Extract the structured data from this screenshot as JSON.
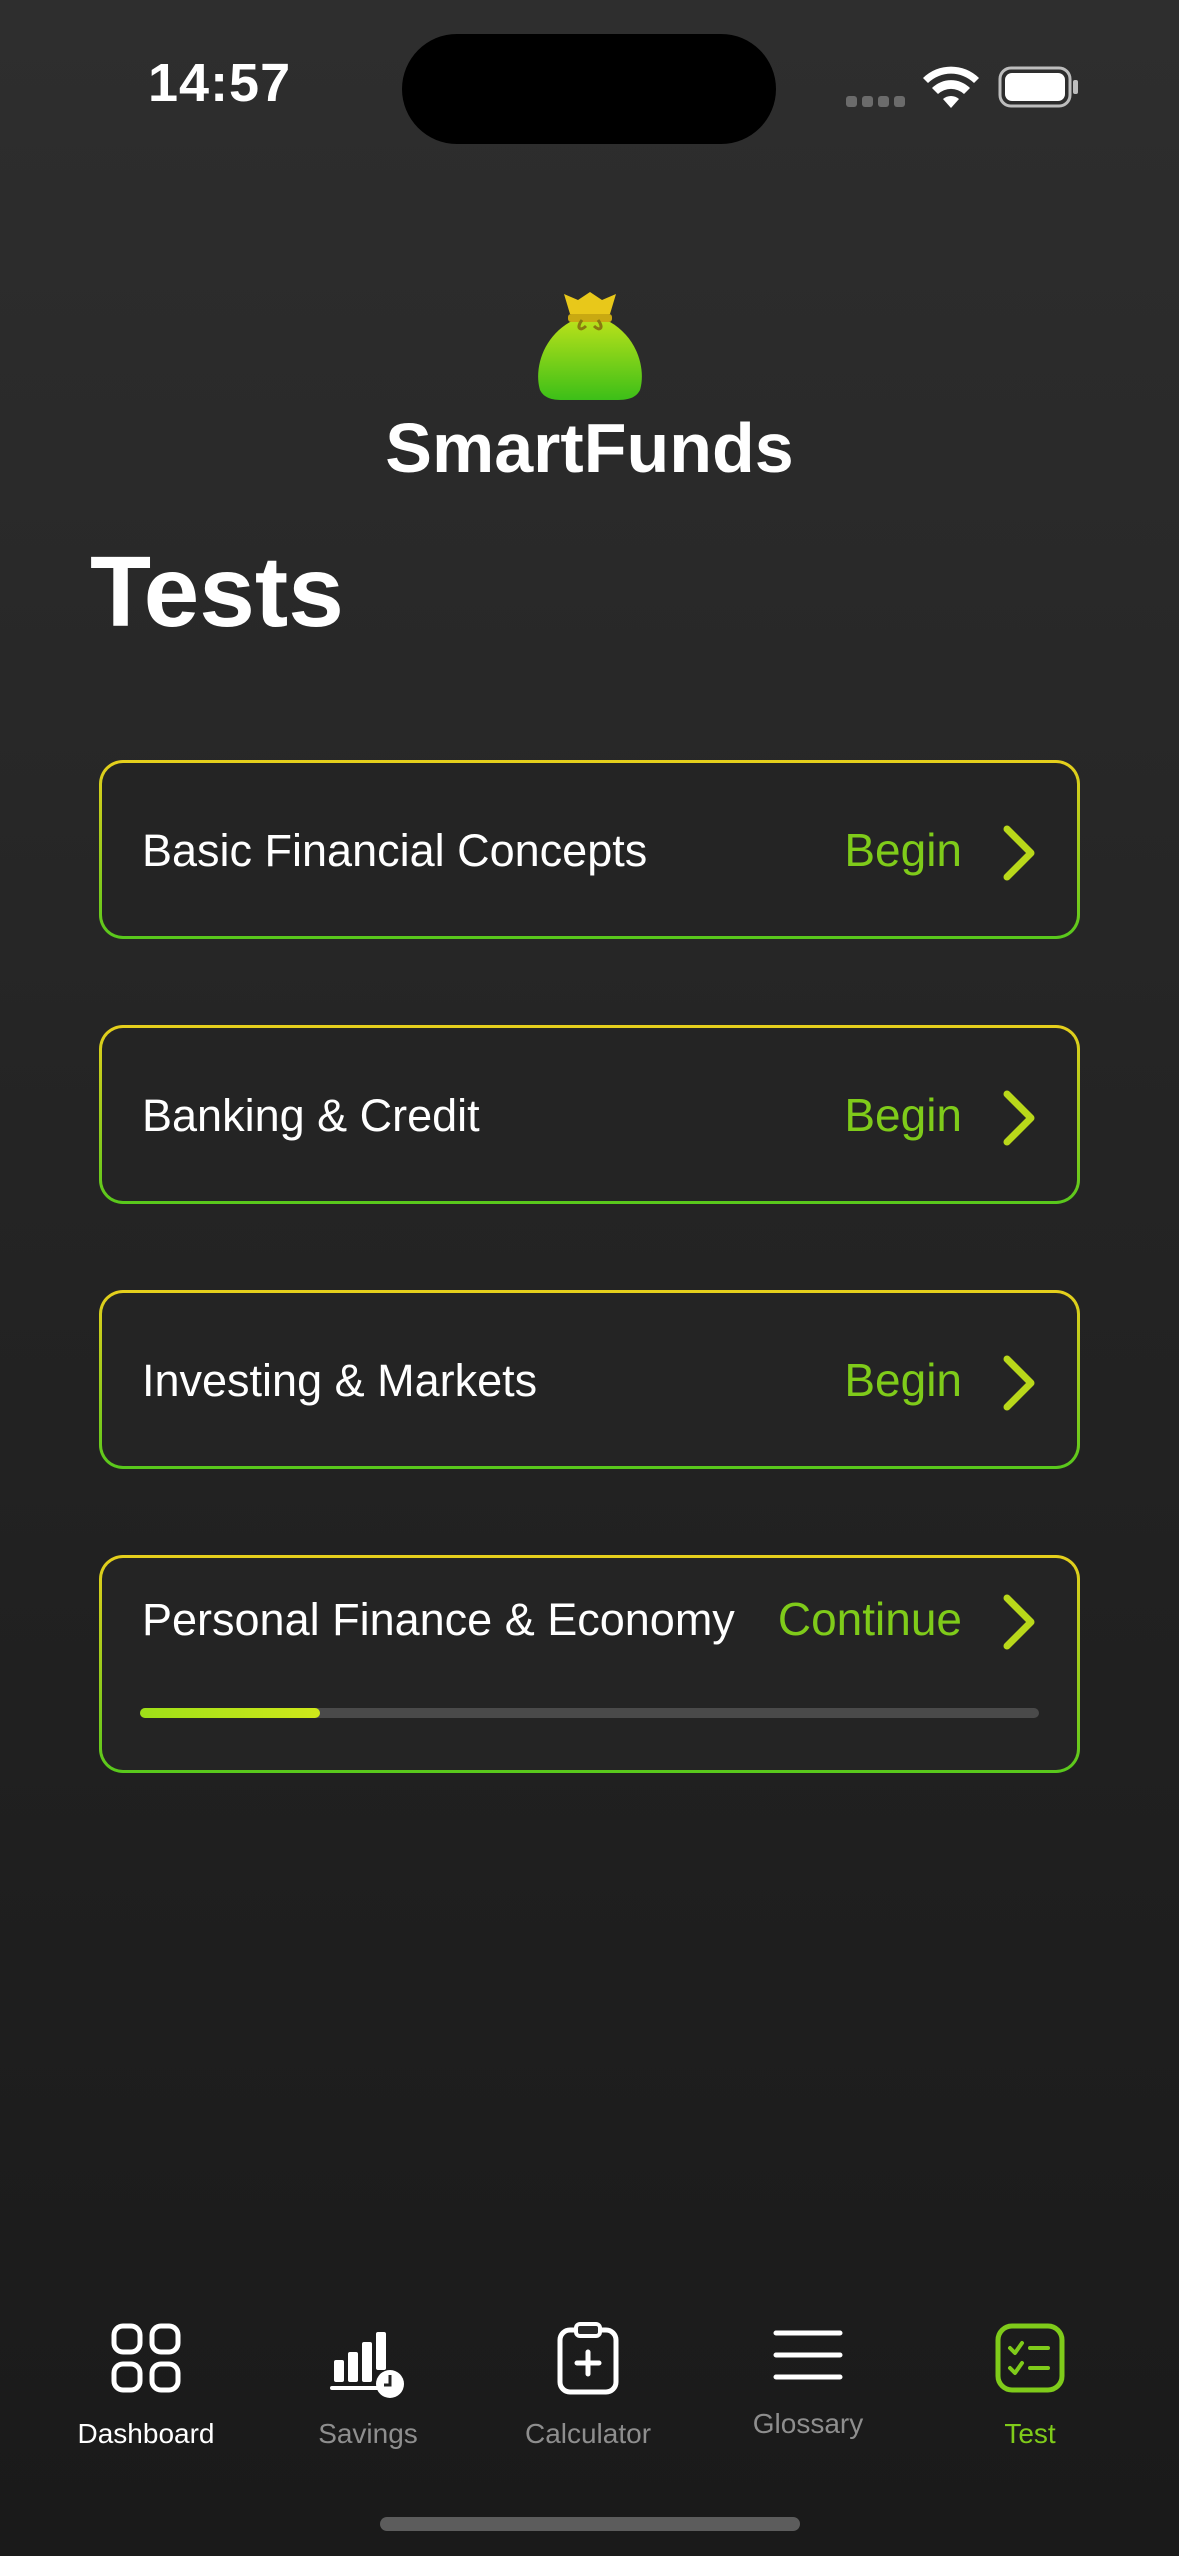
{
  "status_bar": {
    "time": "14:57"
  },
  "app": {
    "name": "SmartFunds",
    "logo_icon": "money-bag-icon"
  },
  "page": {
    "title": "Tests"
  },
  "tests": [
    {
      "title": "Basic Financial Concepts",
      "action": "Begin"
    },
    {
      "title": "Banking & Credit",
      "action": "Begin"
    },
    {
      "title": "Investing & Markets",
      "action": "Begin"
    },
    {
      "title": "Personal Finance & Economy",
      "action": "Continue",
      "progress": 0.2
    }
  ],
  "tab_bar": {
    "items": [
      {
        "label": "Dashboard",
        "icon": "grid-icon"
      },
      {
        "label": "Savings",
        "icon": "savings-chart-icon"
      },
      {
        "label": "Calculator",
        "icon": "clipboard-plus-icon"
      },
      {
        "label": "Glossary",
        "icon": "menu-lines-icon"
      },
      {
        "label": "Test",
        "icon": "checklist-icon"
      }
    ]
  },
  "colors": {
    "accent_green": "#7fcb1a",
    "border_top": "#e6cf1c",
    "border_bottom": "#58c81c",
    "background": "#242424"
  }
}
